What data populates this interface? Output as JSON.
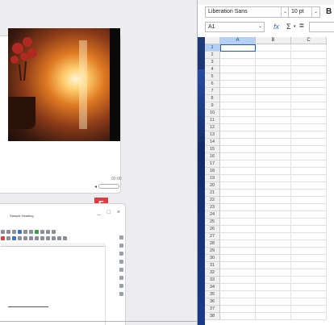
{
  "video_window": {
    "title_buttons": [
      "_",
      "□",
      "×"
    ],
    "time_label": "00:00",
    "volume_label": "◂"
  },
  "badge": {
    "number": "5"
  },
  "writer_window": {
    "title_buttons": [
      "_",
      "□",
      "×"
    ],
    "heading_text": "Sample Heading"
  },
  "calc": {
    "font_name": "Liberation Sans",
    "font_size": "10 pt",
    "bold_label": "B",
    "name_box": "A1",
    "fx_label": "fx",
    "sum_label": "Σ",
    "sum_dd": "▾",
    "eq_label": "=",
    "dropdown_arrow": "⌄",
    "columns": [
      "A",
      "B",
      "C"
    ],
    "rows": [
      "1",
      "2",
      "3",
      "4",
      "5",
      "6",
      "7",
      "8",
      "9",
      "10",
      "11",
      "12",
      "13",
      "14",
      "15",
      "16",
      "17",
      "18",
      "19",
      "20",
      "21",
      "22",
      "23",
      "24",
      "25",
      "26",
      "27",
      "28",
      "29",
      "30",
      "31",
      "32",
      "33",
      "34",
      "35",
      "36",
      "37",
      "38"
    ],
    "selected_cell": "A1"
  },
  "colors": {
    "accent": "#1e5bbd",
    "badge": "#e0393e",
    "selection_header": "#b4d0f4"
  }
}
